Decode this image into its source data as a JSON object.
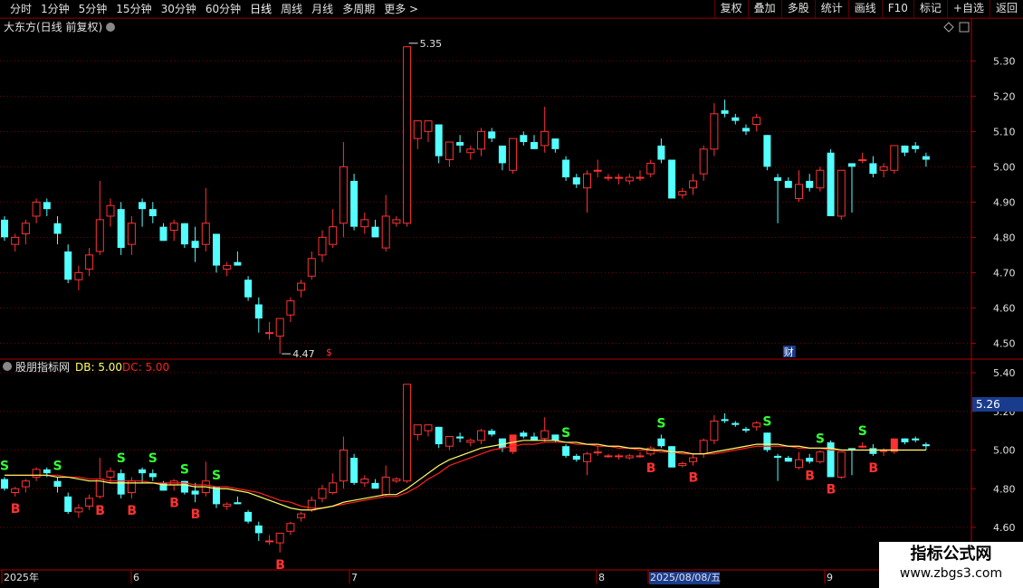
{
  "toolbar": {
    "periods": [
      "分时",
      "1分钟",
      "5分钟",
      "15分钟",
      "30分钟",
      "60分钟",
      "日线",
      "周线",
      "月线",
      "多周期",
      "更多 >"
    ],
    "active_period": "日线",
    "actions": [
      "复权",
      "叠加",
      "多股",
      "统计",
      "画线",
      "F10",
      "标记",
      "+自选",
      "返回"
    ]
  },
  "colors": {
    "up": "#ff3232",
    "down": "#54ffff",
    "grid": "#7a0000",
    "axis_text": "#e0e0e0",
    "ma_yellow": "#ffff66",
    "ma_red": "#ff2020",
    "signal_s": "#33ff33",
    "signal_b": "#ff3232"
  },
  "main_panel": {
    "title": "大东方(日线 前复权)",
    "high_marker": "5.35",
    "low_marker": "4.47",
    "badge_a": "$",
    "badge_b": "财"
  },
  "indicator_panel": {
    "title": "股朋指标网",
    "db_label": "DB: 5.00",
    "dc_label": "DC: 5.00",
    "last_value": "5.26"
  },
  "x_axis": {
    "labels": [
      "2025年",
      "6",
      "7",
      "8",
      "2025/08/08/五",
      "9"
    ]
  },
  "watermark": {
    "line1": "指标公式网",
    "line2": "www.zbgs3.com"
  },
  "chart_data": [
    {
      "type": "candlestick",
      "title": "大东方(日线 前复权)",
      "y_ticks": [
        5.3,
        5.2,
        5.1,
        5.0,
        4.9,
        4.8,
        4.7,
        4.6,
        4.5
      ],
      "ylim": [
        4.46,
        5.37
      ],
      "ohlc": [
        [
          4.85,
          4.86,
          4.79,
          4.8
        ],
        [
          4.78,
          4.81,
          4.76,
          4.8
        ],
        [
          4.81,
          4.85,
          4.78,
          4.84
        ],
        [
          4.86,
          4.91,
          4.84,
          4.9
        ],
        [
          4.9,
          4.91,
          4.86,
          4.88
        ],
        [
          4.84,
          4.86,
          4.78,
          4.81
        ],
        [
          4.76,
          4.78,
          4.67,
          4.68
        ],
        [
          4.68,
          4.72,
          4.65,
          4.7
        ],
        [
          4.71,
          4.77,
          4.69,
          4.75
        ],
        [
          4.76,
          4.96,
          4.75,
          4.85
        ],
        [
          4.86,
          4.91,
          4.83,
          4.89
        ],
        [
          4.88,
          4.9,
          4.75,
          4.77
        ],
        [
          4.78,
          4.86,
          4.75,
          4.84
        ],
        [
          4.9,
          4.91,
          4.83,
          4.88
        ],
        [
          4.88,
          4.9,
          4.84,
          4.86
        ],
        [
          4.83,
          4.84,
          4.79,
          4.79
        ],
        [
          4.82,
          4.85,
          4.79,
          4.84
        ],
        [
          4.84,
          4.84,
          4.77,
          4.78
        ],
        [
          4.79,
          4.83,
          4.73,
          4.77
        ],
        [
          4.78,
          4.94,
          4.76,
          4.84
        ],
        [
          4.81,
          4.81,
          4.7,
          4.72
        ],
        [
          4.71,
          4.73,
          4.69,
          4.72
        ],
        [
          4.73,
          4.76,
          4.72,
          4.72
        ],
        [
          4.68,
          4.69,
          4.62,
          4.63
        ],
        [
          4.61,
          4.63,
          4.53,
          4.57
        ],
        [
          4.53,
          4.56,
          4.51,
          4.53
        ],
        [
          4.52,
          4.57,
          4.47,
          4.57
        ],
        [
          4.58,
          4.63,
          4.56,
          4.62
        ],
        [
          4.65,
          4.68,
          4.63,
          4.67
        ],
        [
          4.69,
          4.76,
          4.68,
          4.74
        ],
        [
          4.75,
          4.82,
          4.73,
          4.8
        ],
        [
          4.78,
          4.88,
          4.77,
          4.83
        ],
        [
          4.84,
          5.07,
          4.8,
          5.0
        ],
        [
          4.96,
          4.98,
          4.82,
          4.83
        ],
        [
          4.83,
          4.87,
          4.81,
          4.85
        ],
        [
          4.83,
          4.85,
          4.8,
          4.8
        ],
        [
          4.77,
          4.92,
          4.76,
          4.86
        ],
        [
          4.84,
          4.86,
          4.83,
          4.85
        ],
        [
          4.84,
          5.34,
          4.83,
          5.34
        ],
        [
          5.08,
          5.13,
          5.05,
          5.13
        ],
        [
          5.1,
          5.13,
          5.07,
          5.13
        ],
        [
          5.12,
          5.12,
          5.01,
          5.03
        ],
        [
          5.02,
          5.07,
          5.0,
          5.07
        ],
        [
          5.07,
          5.09,
          5.04,
          5.06
        ],
        [
          5.04,
          5.06,
          5.02,
          5.05
        ],
        [
          5.05,
          5.11,
          5.03,
          5.1
        ],
        [
          5.1,
          5.11,
          5.07,
          5.08
        ],
        [
          5.06,
          5.06,
          4.99,
          5.01
        ],
        [
          4.99,
          5.08,
          4.98,
          5.08
        ],
        [
          5.09,
          5.1,
          5.06,
          5.07
        ],
        [
          5.07,
          5.09,
          5.05,
          5.05
        ],
        [
          5.06,
          5.17,
          5.04,
          5.1
        ],
        [
          5.08,
          5.08,
          5.04,
          5.05
        ],
        [
          5.02,
          5.03,
          4.96,
          4.97
        ],
        [
          4.97,
          4.98,
          4.94,
          4.95
        ],
        [
          4.94,
          4.99,
          4.87,
          4.98
        ],
        [
          4.99,
          5.02,
          4.97,
          4.99
        ],
        [
          4.97,
          4.98,
          4.96,
          4.97
        ],
        [
          4.97,
          4.98,
          4.95,
          4.97
        ],
        [
          4.96,
          4.98,
          4.95,
          4.97
        ],
        [
          4.97,
          4.99,
          4.96,
          4.97
        ],
        [
          4.98,
          5.02,
          4.97,
          5.01
        ],
        [
          5.06,
          5.08,
          5.01,
          5.02
        ],
        [
          5.02,
          5.02,
          4.91,
          4.91
        ],
        [
          4.92,
          4.94,
          4.91,
          4.93
        ],
        [
          4.94,
          4.98,
          4.92,
          4.96
        ],
        [
          4.98,
          5.06,
          4.96,
          5.05
        ],
        [
          5.05,
          5.18,
          5.03,
          5.15
        ],
        [
          5.16,
          5.19,
          5.14,
          5.15
        ],
        [
          5.14,
          5.15,
          5.12,
          5.13
        ],
        [
          5.11,
          5.12,
          5.09,
          5.1
        ],
        [
          5.12,
          5.15,
          5.1,
          5.14
        ],
        [
          5.09,
          5.09,
          4.99,
          5.0
        ],
        [
          4.97,
          4.98,
          4.84,
          4.96
        ],
        [
          4.96,
          4.97,
          4.94,
          4.94
        ],
        [
          4.91,
          4.99,
          4.9,
          4.95
        ],
        [
          4.96,
          4.98,
          4.93,
          4.94
        ],
        [
          4.94,
          5.0,
          4.93,
          4.99
        ],
        [
          5.04,
          5.05,
          4.86,
          4.86
        ],
        [
          4.86,
          4.99,
          4.85,
          4.99
        ],
        [
          5.01,
          5.01,
          4.87,
          5.0
        ],
        [
          5.02,
          5.04,
          5.01,
          5.02
        ],
        [
          5.01,
          5.03,
          4.97,
          4.98
        ],
        [
          4.99,
          5.01,
          4.97,
          5.0
        ],
        [
          4.99,
          5.06,
          4.98,
          5.06
        ],
        [
          5.06,
          5.06,
          5.03,
          5.04
        ],
        [
          5.06,
          5.07,
          5.04,
          5.05
        ],
        [
          5.03,
          5.04,
          5.0,
          5.02
        ]
      ]
    },
    {
      "type": "candlestick_indicator",
      "title": "股朋指标网",
      "y_ticks": [
        5.4,
        5.2,
        5.0,
        4.8,
        4.6
      ],
      "ylim": [
        4.5,
        5.5
      ],
      "series": [
        {
          "name": "DB",
          "values": [
            4.87,
            4.87,
            4.87,
            4.87,
            4.87,
            4.86,
            4.86,
            4.85,
            4.84,
            4.84,
            4.83,
            4.83,
            4.83,
            4.83,
            4.83,
            4.82,
            4.82,
            4.82,
            4.81,
            4.81,
            4.8,
            4.8,
            4.79,
            4.78,
            4.76,
            4.74,
            4.72,
            4.7,
            4.69,
            4.69,
            4.7,
            4.71,
            4.73,
            4.74,
            4.75,
            4.76,
            4.77,
            4.77,
            4.8,
            4.84,
            4.88,
            4.92,
            4.95,
            4.97,
            4.99,
            5.01,
            5.02,
            5.03,
            5.04,
            5.05,
            5.05,
            5.05,
            5.05,
            5.04,
            5.04,
            5.03,
            5.03,
            5.02,
            5.02,
            5.01,
            5.01,
            5.0,
            5.0,
            4.99,
            4.99,
            4.98,
            4.98,
            4.99,
            5.0,
            5.01,
            5.02,
            5.03,
            5.03,
            5.03,
            5.02,
            5.02,
            5.01,
            5.01,
            5.01,
            5.0,
            5.0,
            5.0,
            5.0,
            5.0,
            5.0,
            5.0,
            5.0,
            5.0
          ]
        },
        {
          "name": "DC",
          "values": [
            4.87,
            4.87,
            4.87,
            4.87,
            4.87,
            4.87,
            4.86,
            4.86,
            4.85,
            4.85,
            4.84,
            4.84,
            4.84,
            4.84,
            4.83,
            4.83,
            4.83,
            4.83,
            4.82,
            4.82,
            4.81,
            4.81,
            4.8,
            4.79,
            4.78,
            4.76,
            4.74,
            4.73,
            4.71,
            4.7,
            4.7,
            4.71,
            4.72,
            4.73,
            4.74,
            4.75,
            4.76,
            4.76,
            4.78,
            4.81,
            4.85,
            4.88,
            4.92,
            4.94,
            4.96,
            4.98,
            5.0,
            5.01,
            5.02,
            5.03,
            5.03,
            5.04,
            5.04,
            5.04,
            5.03,
            5.03,
            5.02,
            5.02,
            5.01,
            5.01,
            5.0,
            5.0,
            4.99,
            4.99,
            4.98,
            4.98,
            4.98,
            4.98,
            4.99,
            5.0,
            5.01,
            5.02,
            5.02,
            5.02,
            5.02,
            5.01,
            5.01,
            5.01,
            5.0,
            5.0,
            5.0,
            5.0,
            5.0,
            5.0,
            5.0,
            5.0,
            5.0,
            5.0
          ]
        }
      ],
      "signals_s": [
        0,
        5,
        11,
        14,
        17,
        20,
        53,
        62,
        72,
        77,
        81
      ],
      "signals_b": [
        1,
        9,
        12,
        16,
        18,
        26,
        61,
        65,
        76,
        78,
        82
      ],
      "signal_labels": {
        "s": "S",
        "b": "B"
      }
    }
  ]
}
